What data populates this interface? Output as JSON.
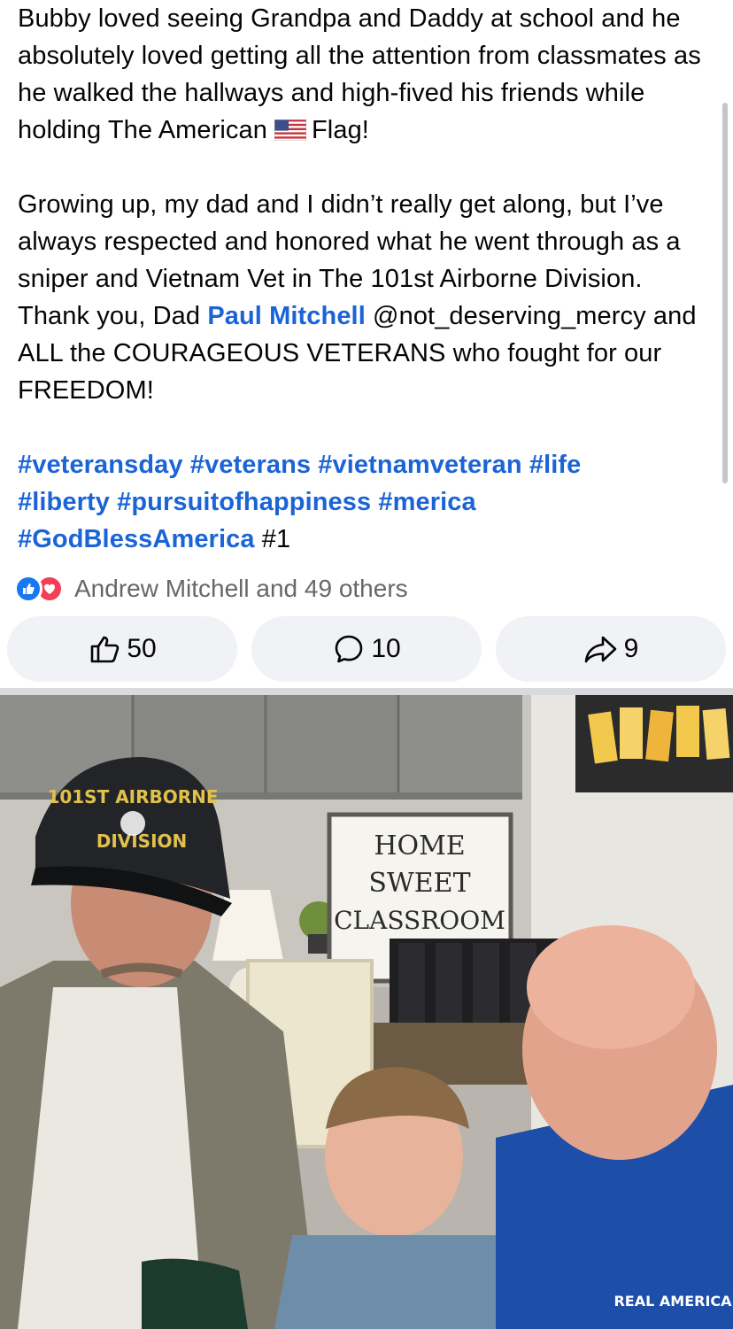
{
  "post": {
    "para1_before_flag": "Bubby loved seeing Grandpa and Daddy at school and he absolutely loved getting all the attention from classmates as he walked the hallways and high-fived his friends while holding The American",
    "para1_after_flag": "Flag!",
    "flag_icon": "us-flag-emoji",
    "para2_before_mention": "Growing up, my dad and I didn’t really get along, but I’ve always respected and honored what he went through as a sniper and Vietnam Vet in The 101st Airborne Division. Thank you, Dad",
    "mention": "Paul Mitchell",
    "para2_after_mention": "@not_deserving_mercy and ALL the COURAGEOUS VETERANS who fought for our FREEDOM!",
    "hashtags": [
      "#veteransday",
      "#veterans",
      "#vietnamveteran",
      "#life",
      "#liberty",
      "#pursuitofhappiness",
      "#merica",
      "#GodBlessAmerica"
    ],
    "hashtag_suffix": "#1"
  },
  "reactions": {
    "icons": [
      "like-icon",
      "love-icon"
    ],
    "summary": "Andrew Mitchell and 49 others"
  },
  "actions": {
    "like_count": "50",
    "comment_count": "10",
    "share_count": "9"
  },
  "photo": {
    "hat_line1": "101ST AIRBORNE",
    "hat_line2": "DIVISION",
    "sign_line1": "HOME",
    "sign_line2": "SWEET",
    "sign_line3": "CLASSROOM",
    "shirt_text": "REAL AMERICA"
  },
  "colors": {
    "link": "#1b64d6",
    "like": "#1877f2",
    "love": "#f33e58",
    "button_bg": "#f0f2f5",
    "secondary_text": "#65676b"
  }
}
